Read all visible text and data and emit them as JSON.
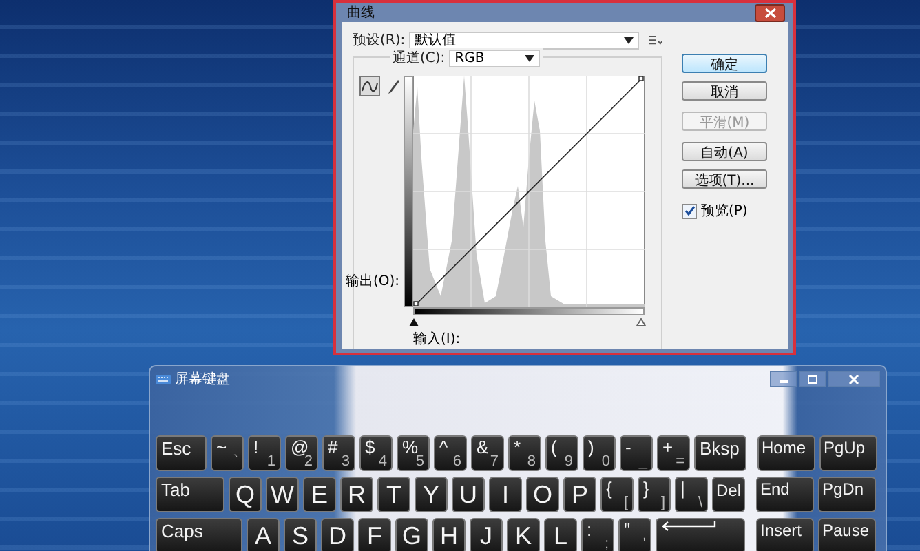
{
  "curves_dialog": {
    "title": "曲线",
    "preset": {
      "label": "预设(R):",
      "value": "默认值"
    },
    "channel": {
      "label": "通道(C):",
      "value": "RGB"
    },
    "output_label": "输出(O):",
    "input_label": "输入(I):",
    "tools": [
      {
        "kind": "curve",
        "selected": true
      },
      {
        "kind": "pencil",
        "selected": false
      }
    ],
    "buttons": [
      {
        "label": "确定",
        "default": true,
        "disabled": false
      },
      {
        "label": "取消",
        "default": false,
        "disabled": false
      },
      {
        "label": "平滑(M)",
        "default": false,
        "disabled": true
      },
      {
        "label": "自动(A)",
        "default": false,
        "disabled": false
      },
      {
        "label": "选项(T)...",
        "default": false,
        "disabled": false
      }
    ],
    "preview": {
      "label": "预览(P)",
      "checked": true
    }
  },
  "keyboard": {
    "title": "屏幕键盘",
    "key_rows": [
      {
        "keys": [
          {
            "kind": "esc",
            "label": "Esc"
          },
          {
            "kind": "char",
            "upper": "~",
            "lower": "`"
          },
          {
            "kind": "char",
            "upper": "!",
            "lower": "1"
          },
          {
            "kind": "char",
            "upper": "@",
            "lower": "2"
          },
          {
            "kind": "char",
            "upper": "#",
            "lower": "3"
          },
          {
            "kind": "char",
            "upper": "$",
            "lower": "4"
          },
          {
            "kind": "char",
            "upper": "%",
            "lower": "5"
          },
          {
            "kind": "char",
            "upper": "^",
            "lower": "6"
          },
          {
            "kind": "char",
            "upper": "&",
            "lower": "7"
          },
          {
            "kind": "char",
            "upper": "*",
            "lower": "8"
          },
          {
            "kind": "char",
            "upper": "(",
            "lower": "9"
          },
          {
            "kind": "char",
            "upper": ")",
            "lower": "0"
          },
          {
            "kind": "char",
            "upper": "-",
            "lower": "_"
          },
          {
            "kind": "char",
            "upper": "+",
            "lower": "="
          },
          {
            "kind": "bksp",
            "label": "Bksp"
          },
          {
            "kind": "nav",
            "label": "Home"
          },
          {
            "kind": "nav",
            "label": "PgUp"
          }
        ]
      },
      {
        "keys": [
          {
            "kind": "tab",
            "label": "Tab"
          },
          {
            "kind": "char",
            "label": "Q"
          },
          {
            "kind": "char",
            "label": "W"
          },
          {
            "kind": "char",
            "label": "E"
          },
          {
            "kind": "char",
            "label": "R"
          },
          {
            "kind": "char",
            "label": "T"
          },
          {
            "kind": "char",
            "label": "Y"
          },
          {
            "kind": "char",
            "label": "U"
          },
          {
            "kind": "char",
            "label": "I"
          },
          {
            "kind": "char",
            "label": "O"
          },
          {
            "kind": "char",
            "label": "P"
          },
          {
            "kind": "char",
            "upper": "{",
            "lower": "["
          },
          {
            "kind": "char",
            "upper": "}",
            "lower": "]"
          },
          {
            "kind": "char",
            "upper": "|",
            "lower": "\\"
          },
          {
            "kind": "small",
            "label": "Del"
          },
          {
            "kind": "nav",
            "label": "End"
          },
          {
            "kind": "nav",
            "label": "PgDn"
          }
        ]
      },
      {
        "keys": [
          {
            "kind": "caps",
            "label": "Caps"
          },
          {
            "kind": "char",
            "label": "A"
          },
          {
            "kind": "char",
            "label": "S"
          },
          {
            "kind": "char",
            "label": "D"
          },
          {
            "kind": "char",
            "label": "F"
          },
          {
            "kind": "char",
            "label": "G"
          },
          {
            "kind": "char",
            "label": "H"
          },
          {
            "kind": "char",
            "label": "J"
          },
          {
            "kind": "char",
            "label": "K"
          },
          {
            "kind": "char",
            "label": "L"
          },
          {
            "kind": "char",
            "upper": ":",
            "lower": ";"
          },
          {
            "kind": "char",
            "upper": "\"",
            "lower": "'"
          },
          {
            "kind": "enter"
          },
          {
            "kind": "nav",
            "label": "Insert"
          },
          {
            "kind": "nav",
            "label": "Pause"
          }
        ]
      }
    ]
  }
}
